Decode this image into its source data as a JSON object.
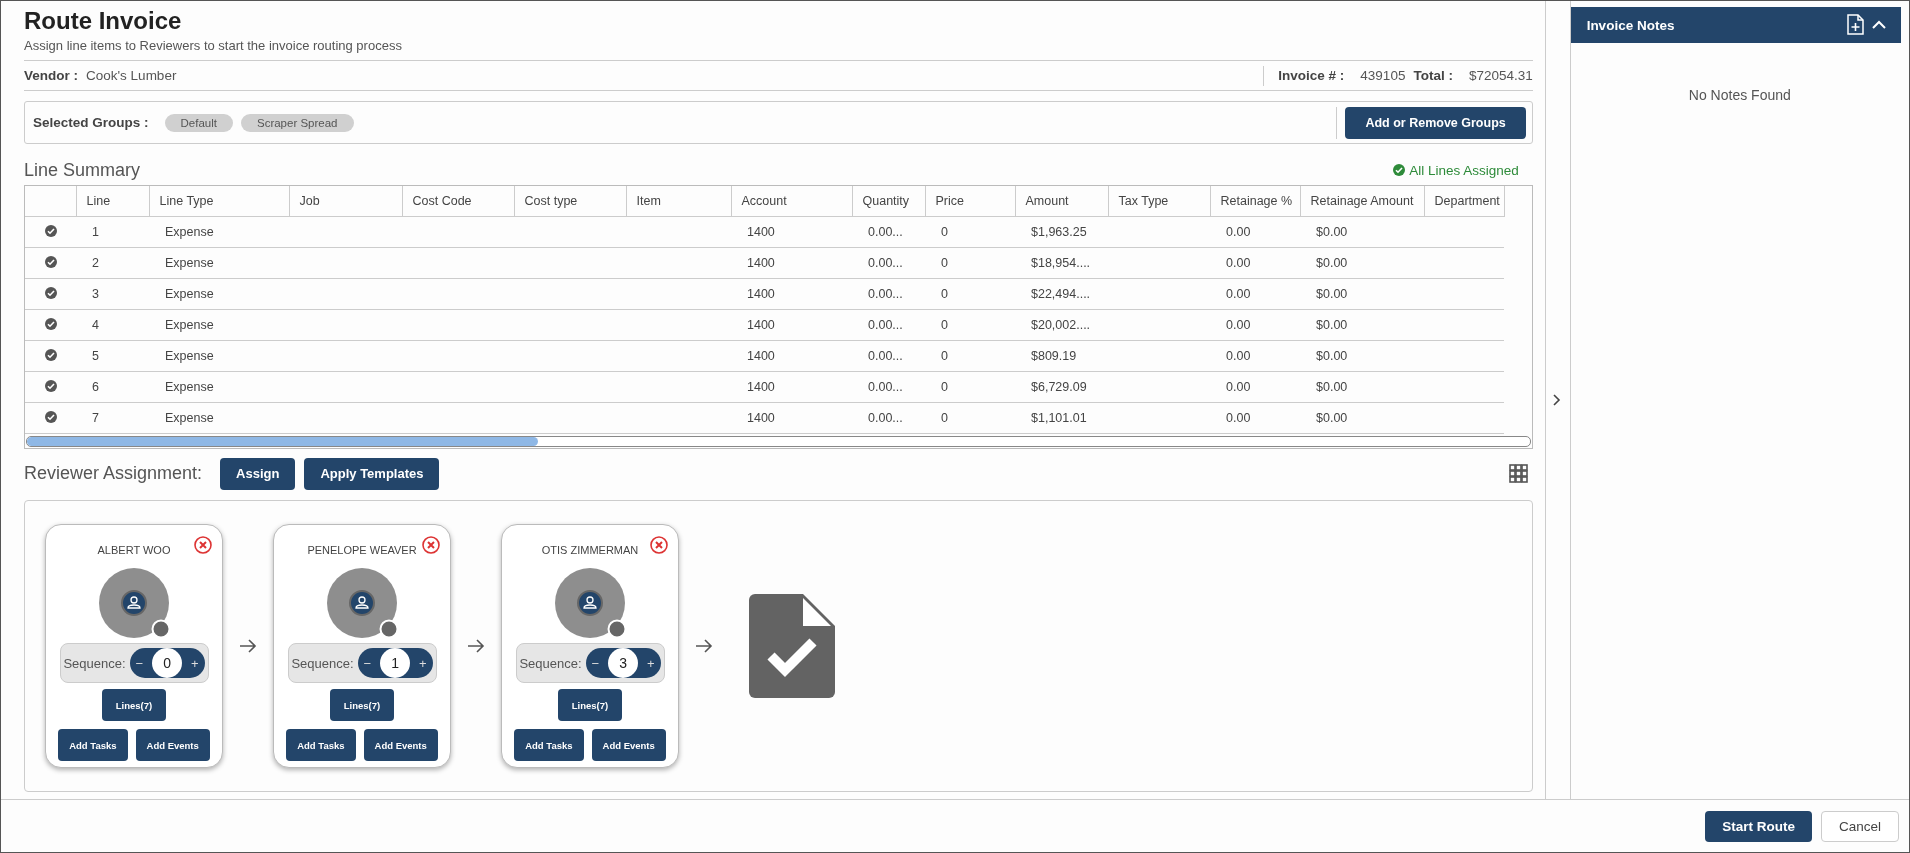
{
  "header": {
    "title": "Route Invoice",
    "subtitle": "Assign line items to Reviewers to start the invoice routing process"
  },
  "vendor": {
    "label": "Vendor :",
    "value": "Cook's Lumber"
  },
  "invoice": {
    "number_label": "Invoice # :",
    "number": "439105",
    "total_label": "Total :",
    "total": "$72054.31"
  },
  "groups": {
    "label": "Selected Groups :",
    "chips": [
      "Default",
      "Scraper Spread"
    ],
    "button": "Add or Remove Groups"
  },
  "line_summary": {
    "title": "Line Summary",
    "status": "All Lines Assigned",
    "columns": [
      "",
      "Line",
      "Line Type",
      "Job",
      "Cost Code",
      "Cost type",
      "Item",
      "Account",
      "Quantity",
      "Price",
      "Amount",
      "Tax Type",
      "Retainage %",
      "Retainage Amount",
      "Department"
    ],
    "rows": [
      {
        "assigned": true,
        "cells": [
          "",
          "1",
          "Expense",
          "",
          "",
          "",
          "",
          "1400",
          "0.00...",
          "0",
          "$1,963.25",
          "",
          "0.00",
          "$0.00",
          ""
        ]
      },
      {
        "assigned": true,
        "cells": [
          "",
          "2",
          "Expense",
          "",
          "",
          "",
          "",
          "1400",
          "0.00...",
          "0",
          "$18,954....",
          "",
          "0.00",
          "$0.00",
          ""
        ]
      },
      {
        "assigned": true,
        "cells": [
          "",
          "3",
          "Expense",
          "",
          "",
          "",
          "",
          "1400",
          "0.00...",
          "0",
          "$22,494....",
          "",
          "0.00",
          "$0.00",
          ""
        ]
      },
      {
        "assigned": true,
        "cells": [
          "",
          "4",
          "Expense",
          "",
          "",
          "",
          "",
          "1400",
          "0.00...",
          "0",
          "$20,002....",
          "",
          "0.00",
          "$0.00",
          ""
        ]
      },
      {
        "assigned": true,
        "cells": [
          "",
          "5",
          "Expense",
          "",
          "",
          "",
          "",
          "1400",
          "0.00...",
          "0",
          "$809.19",
          "",
          "0.00",
          "$0.00",
          ""
        ]
      },
      {
        "assigned": true,
        "cells": [
          "",
          "6",
          "Expense",
          "",
          "",
          "",
          "",
          "1400",
          "0.00...",
          "0",
          "$6,729.09",
          "",
          "0.00",
          "$0.00",
          ""
        ]
      },
      {
        "assigned": true,
        "cells": [
          "",
          "7",
          "Expense",
          "",
          "",
          "",
          "",
          "1400",
          "0.00...",
          "0",
          "$1,101.01",
          "",
          "0.00",
          "$0.00",
          ""
        ]
      }
    ]
  },
  "reviewer_assignment": {
    "title": "Reviewer Assignment:",
    "buttons": [
      "Assign",
      "Apply Templates"
    ],
    "reviewers": [
      {
        "name": "ALBERT WOO",
        "sequence_label": "Sequence:",
        "minus": "−",
        "sequence": "0",
        "plus": "+",
        "lines_button": "Lines(7)",
        "buttons": [
          "Add Tasks",
          "Add Events"
        ]
      },
      {
        "name": "PENELOPE WEAVER",
        "sequence_label": "Sequence:",
        "minus": "−",
        "sequence": "1",
        "plus": "+",
        "lines_button": "Lines(7)",
        "buttons": [
          "Add Tasks",
          "Add Events"
        ]
      },
      {
        "name": "OTIS ZIMMERMAN",
        "sequence_label": "Sequence:",
        "minus": "−",
        "sequence": "3",
        "plus": "+",
        "lines_button": "Lines(7)",
        "buttons": [
          "Add Tasks",
          "Add Events"
        ]
      }
    ]
  },
  "notes_panel": {
    "title": "Invoice Notes",
    "empty_text": "No Notes Found",
    "expanded": true
  },
  "footer": {
    "buttons": [
      {
        "label": "Start Route",
        "kind": "primary"
      },
      {
        "label": "Cancel",
        "kind": "secondary"
      }
    ]
  }
}
